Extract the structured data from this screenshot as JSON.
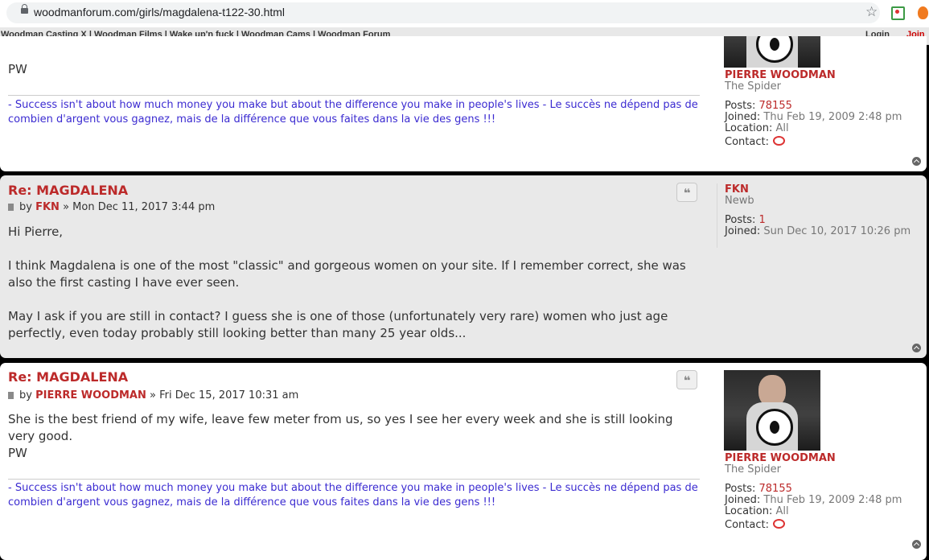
{
  "browser": {
    "url": "woodmanforum.com/girls/magdalena-t122-30.html"
  },
  "nav": {
    "links": [
      "Woodman Casting X",
      "Woodman Films",
      "Wake up'n fuck",
      "Woodman Cams",
      "Woodman Forum"
    ],
    "separator": "|",
    "login": "Login",
    "join": "Join"
  },
  "post1": {
    "body": "PW",
    "signature": "- Success isn't about how much money you make but about the difference you make in people's lives - Le succès ne dépend pas de combien d'argent vous gagnez, mais de la différence que vous faites dans la vie des gens !!!",
    "profile": {
      "name": "PIERRE WOODMAN",
      "rank": "The Spider",
      "posts_label": "Posts:",
      "posts": "78155",
      "joined_label": "Joined:",
      "joined": "Thu Feb 19, 2009 2:48 pm",
      "location_label": "Location:",
      "location": "All",
      "contact_label": "Contact:"
    }
  },
  "post2": {
    "title": "Re: MAGDALENA",
    "by": "by",
    "author": "FKN",
    "date": "» Mon Dec 11, 2017 3:44 pm",
    "p1": "Hi Pierre,",
    "p2": "I think Magdalena is one of the most \"classic\" and gorgeous women on your site. If I remember correct, she was also the first casting I have ever seen.",
    "p3": "May I ask if you are still in contact? I guess she is one of those (unfortunately very rare) women who just age perfectly, even today probably still looking better than many 25 year olds...",
    "quote_icon": "❝",
    "profile": {
      "name": "FKN",
      "rank": "Newb",
      "posts_label": "Posts:",
      "posts": "1",
      "joined_label": "Joined:",
      "joined": "Sun Dec 10, 2017 10:26 pm"
    }
  },
  "post3": {
    "title": "Re: MAGDALENA",
    "by": "by",
    "author": "PIERRE WOODMAN",
    "date": "» Fri Dec 15, 2017 10:31 am",
    "p1": "She is the best friend of my wife, leave few meter from us, so yes I see her every week and she is still looking very good.",
    "p2": "PW",
    "quote_icon": "❝",
    "signature": "- Success isn't about how much money you make but about the difference you make in people's lives - Le succès ne dépend pas de combien d'argent vous gagnez, mais de la différence que vous faites dans la vie des gens !!!",
    "profile": {
      "name": "PIERRE WOODMAN",
      "rank": "The Spider",
      "posts_label": "Posts:",
      "posts": "78155",
      "joined_label": "Joined:",
      "joined": "Thu Feb 19, 2009 2:48 pm",
      "location_label": "Location:",
      "location": "All",
      "contact_label": "Contact:"
    }
  }
}
